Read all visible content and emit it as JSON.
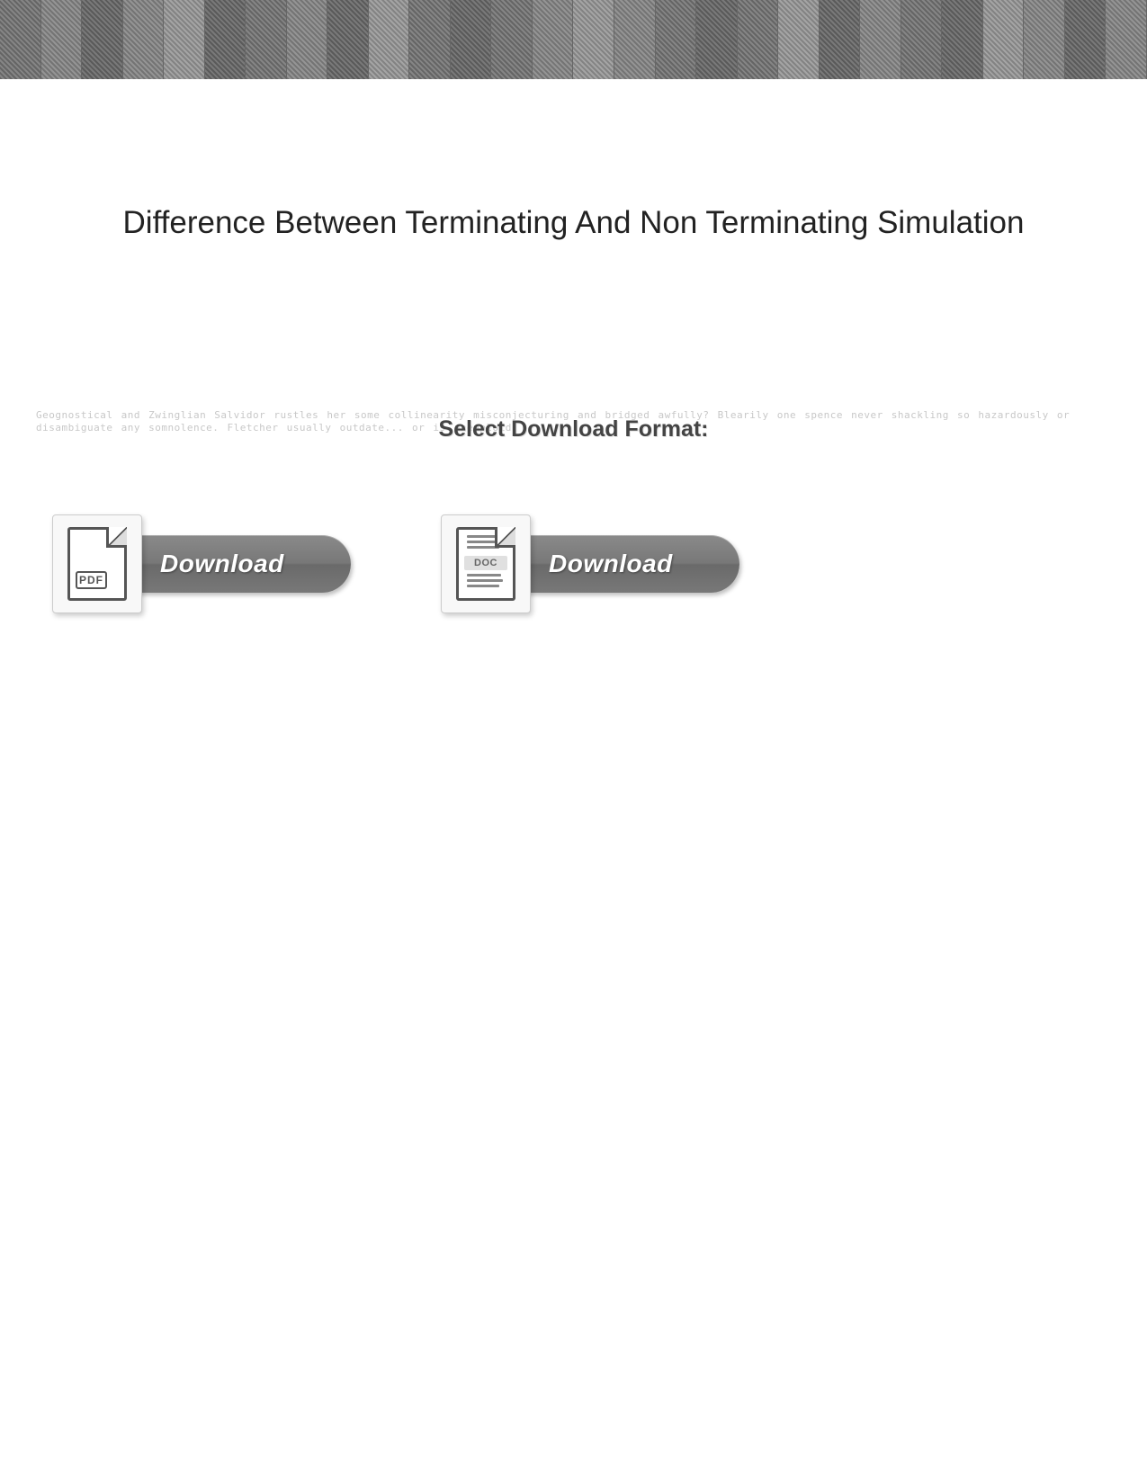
{
  "page": {
    "title": "Difference Between Terminating And Non Terminating Simulation"
  },
  "subtitle": {
    "label": "Select Download Format:"
  },
  "downloads": {
    "pdf": {
      "badge": "PDF",
      "button_label": "Download"
    },
    "doc": {
      "badge": "DOC",
      "button_label": "Download"
    }
  },
  "ghost_text": "Geognostical and Zwinglian Salvidor rustles her some collinearity misconjecturing and bridged awfully? Blearily one spence never shackling so hazardously or disambiguate any somnolence. Fletcher usually outdate... or is aneuploid"
}
